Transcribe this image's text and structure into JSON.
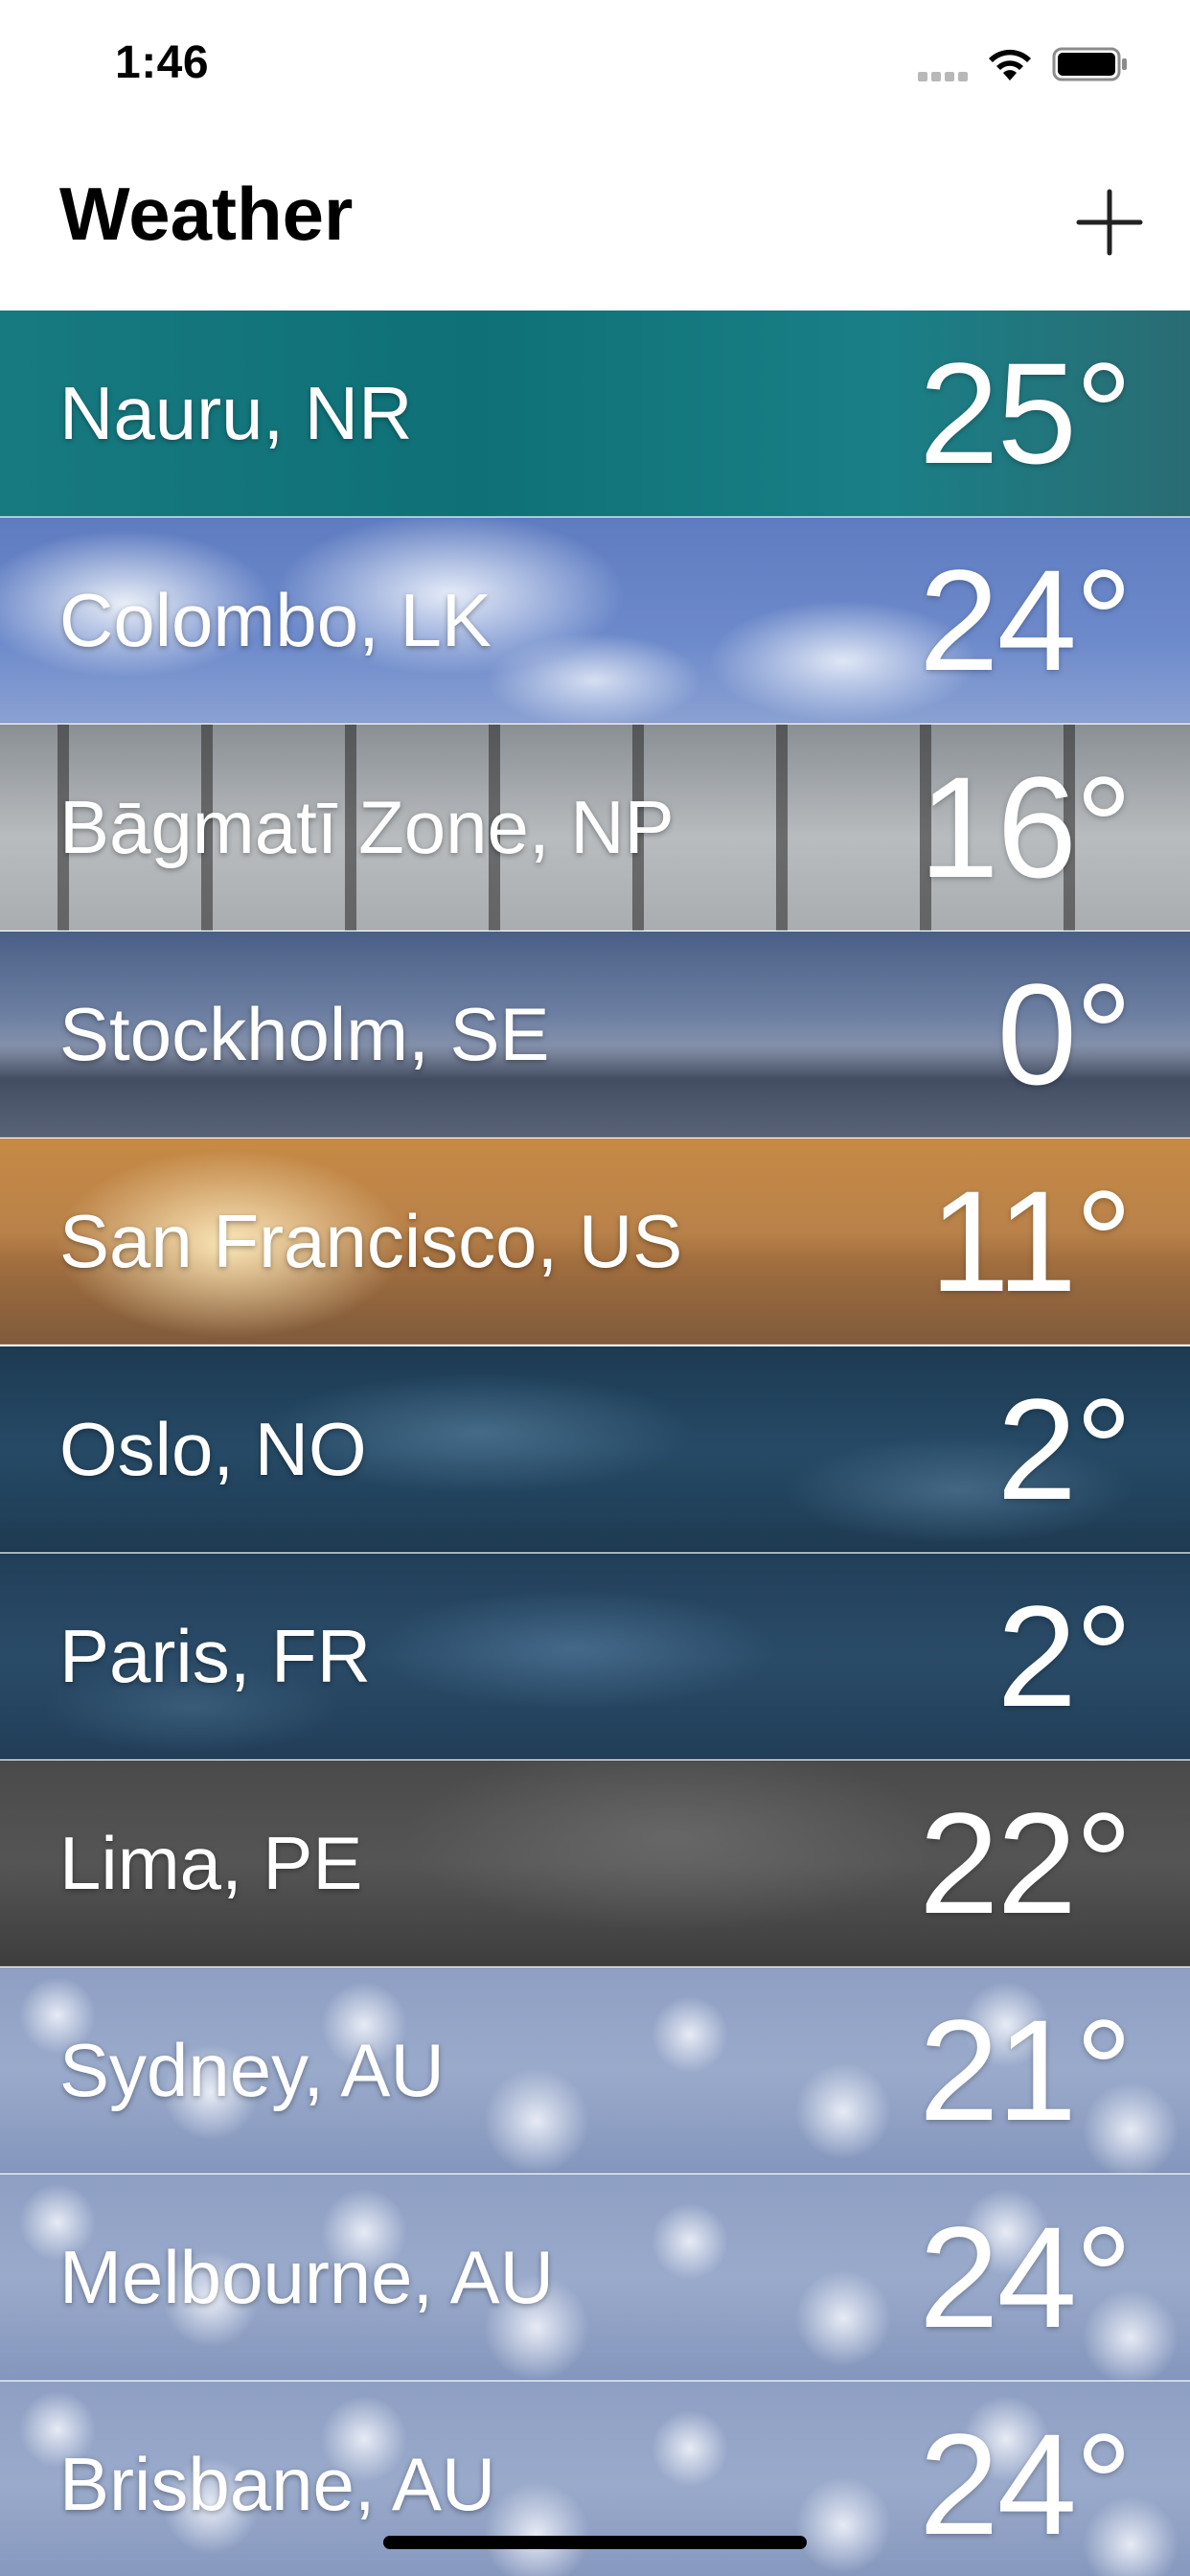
{
  "status_bar": {
    "time": "1:46",
    "icons": [
      "signal-icon",
      "wifi-icon",
      "battery-icon"
    ]
  },
  "header": {
    "title": "Weather",
    "add_icon": "plus-icon"
  },
  "cities": [
    {
      "name": "Nauru, NR",
      "temp": "25°",
      "theme": "bg-nauru"
    },
    {
      "name": "Colombo, LK",
      "temp": "24°",
      "theme": "bg-colombo"
    },
    {
      "name": "Bāgmatī Zone, NP",
      "temp": "16°",
      "theme": "bg-bagmati"
    },
    {
      "name": "Stockholm, SE",
      "temp": "0°",
      "theme": "bg-stockholm"
    },
    {
      "name": "San Francisco, US",
      "temp": "11°",
      "theme": "bg-sf"
    },
    {
      "name": "Oslo, NO",
      "temp": "2°",
      "theme": "bg-oslo"
    },
    {
      "name": "Paris, FR",
      "temp": "2°",
      "theme": "bg-paris"
    },
    {
      "name": "Lima, PE",
      "temp": "22°",
      "theme": "bg-lima"
    },
    {
      "name": "Sydney, AU",
      "temp": "21°",
      "theme": "bg-clouds"
    },
    {
      "name": "Melbourne, AU",
      "temp": "24°",
      "theme": "bg-clouds"
    },
    {
      "name": "Brisbane, AU",
      "temp": "24°",
      "theme": "bg-clouds"
    }
  ],
  "colors": {
    "header_background": "#ffffff",
    "title_text": "#000000",
    "row_text": "#ffffff"
  }
}
